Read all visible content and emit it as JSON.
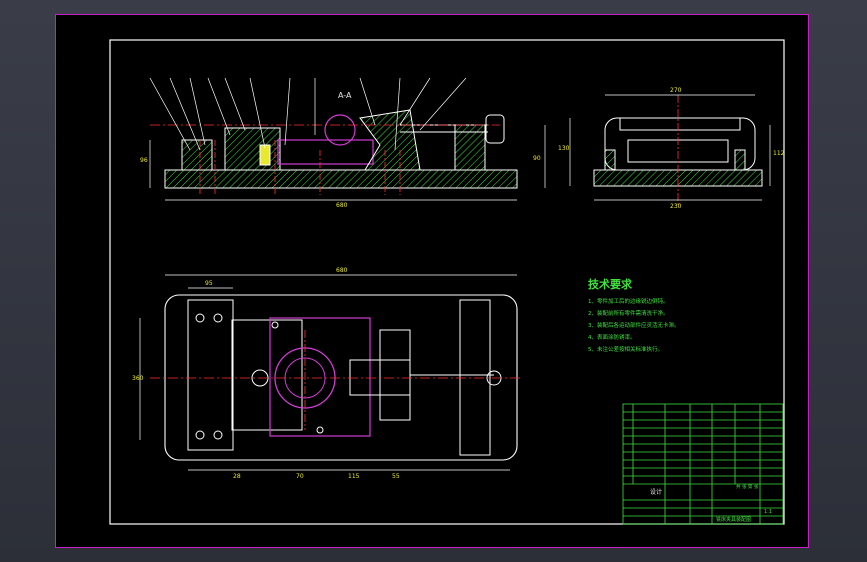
{
  "section_label": "A-A",
  "tech_title": "技术要求",
  "tech_items": [
    "1、零件加工后的边缘锐边倒钝。",
    "2、装配前所有零件需清洗干净。",
    "3、装配后各运动部件应灵活无卡滞。",
    "4、表面涂防锈漆。",
    "5、未注公差按相关标准执行。"
  ],
  "dims": {
    "front_total": "680",
    "front_height": "96",
    "front_right_h": "90",
    "side_top": "270",
    "side_bottom": "230",
    "side_left": "130",
    "side_right": "112",
    "plan_total": "680",
    "plan_sub1": "95",
    "plan_left": "360",
    "plan_d1": "70",
    "plan_d2": "115",
    "plan_d3": "55",
    "plan_d4": "28"
  },
  "title_block": {
    "designer": "设计",
    "drawing_name": "铣床夹具装配图",
    "scale": "1:1",
    "sheet": "共 张 第 张"
  },
  "colors": {
    "border": "#c71fc7",
    "outline": "#ffffff",
    "hatch": "#3fe03f",
    "part_magenta": "#d23cd2",
    "center": "#ff3030",
    "dimension": "#e8e830"
  }
}
